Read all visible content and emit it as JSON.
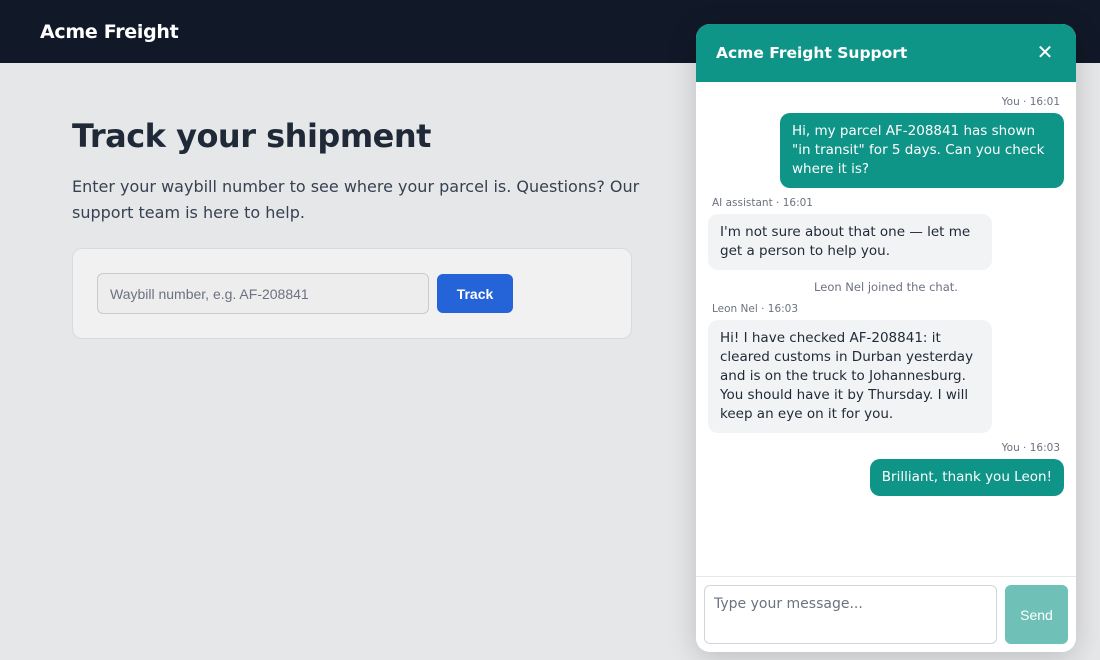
{
  "header": {
    "brand": "Acme Freight"
  },
  "main": {
    "title": "Track your shipment",
    "lead": "Enter your waybill number to see where your parcel is. Questions? Our support team is here to help.",
    "waybill_placeholder": "Waybill number, e.g. AF-208841",
    "track_label": "Track"
  },
  "chat": {
    "title": "Acme Freight Support",
    "close_icon": "close-icon",
    "messages": [
      {
        "meta": "You · 16:01",
        "text": "Hi, my parcel AF-208841 has shown \"in transit\" for 5 days. Can you check where it is?"
      },
      {
        "meta": "AI assistant · 16:01",
        "text": "I'm not sure about that one — let me get a person to help you."
      },
      {
        "system": "Leon Nel joined the chat."
      },
      {
        "meta": "Leon Nel · 16:03",
        "text": "Hi! I have checked AF-208841: it cleared customs in Durban yesterday and is on the truck to Johannesburg. You should have it by Thursday. I will keep an eye on it for you."
      },
      {
        "meta": "You · 16:03",
        "text": "Brilliant, thank you Leon!"
      }
    ],
    "input_placeholder": "Type your message...",
    "send_label": "Send"
  },
  "colors": {
    "topbar": "#111827",
    "accent": "#0f9488",
    "track_button": "#2463d8",
    "send_button_disabled": "#6fc0b7"
  }
}
